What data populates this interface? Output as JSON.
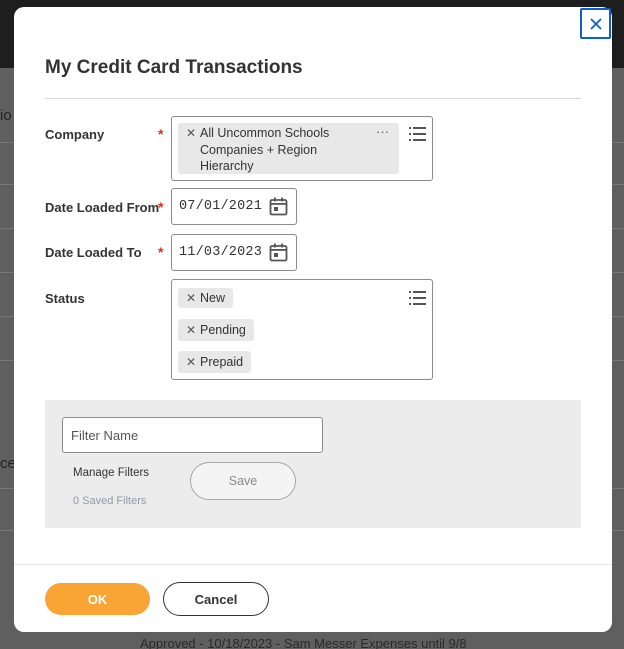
{
  "background": {
    "left_fragments": [
      "io",
      "ce"
    ],
    "bottom_text": "Approved - 10/18/2023 - Sam Messer Expenses until 9/8"
  },
  "dialog": {
    "title": "My Credit Card Transactions",
    "close_icon": "close-icon",
    "fields": {
      "company": {
        "label": "Company",
        "required": "*",
        "selected": [
          "All Uncommon Schools Companies + Region Hierarchy"
        ],
        "more_indicator": "···"
      },
      "date_loaded_from": {
        "label": "Date Loaded From",
        "required": "*",
        "value": "07/01/2021"
      },
      "date_loaded_to": {
        "label": "Date Loaded To",
        "required": "*",
        "value": "11/03/2023"
      },
      "status": {
        "label": "Status",
        "selected": [
          "New",
          "Pending",
          "Prepaid"
        ]
      }
    },
    "filter": {
      "placeholder": "Filter Name",
      "manage_label": "Manage Filters",
      "saved_count_label": "0 Saved Filters",
      "save_label": "Save"
    },
    "footer": {
      "ok_label": "OK",
      "cancel_label": "Cancel"
    },
    "colors": {
      "accent": "#f8a535",
      "required": "#de2e21",
      "focus": "#0c5fcf"
    }
  }
}
